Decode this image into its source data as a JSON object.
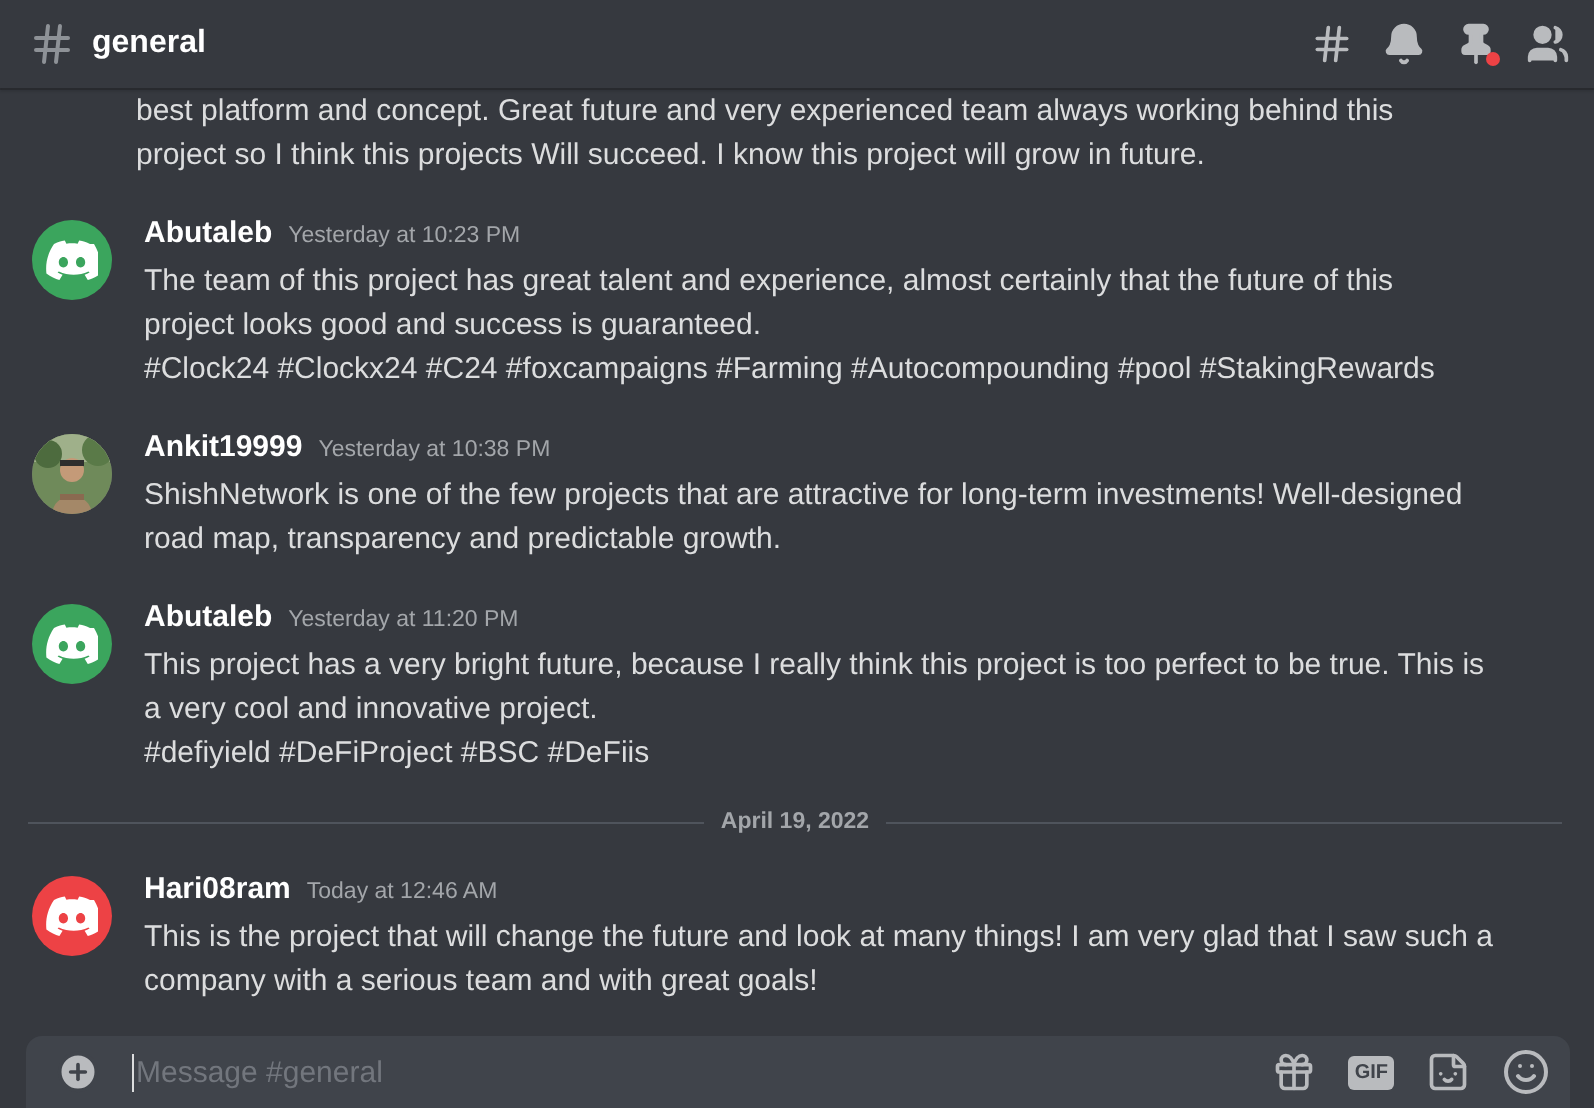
{
  "channel": {
    "name": "general"
  },
  "messages": [
    {
      "kind": "continuation",
      "lines": [
        "best platform and concept. Great future and very experienced team always working behind this",
        "project so I think this projects Will succeed. I know this project will grow in future."
      ]
    },
    {
      "kind": "message",
      "author": "Abutaleb",
      "time": "Yesterday at 10:23 PM",
      "avatar": {
        "kind": "logo",
        "color": "#3ba55d"
      },
      "lines": [
        "The team of this project has great talent and experience, almost certainly that the future of this",
        "project looks good and success is guaranteed.",
        "#Clock24 #Clockx24 #C24 #foxcampaigns #Farming #Autocompounding #pool #StakingRewards"
      ]
    },
    {
      "kind": "message",
      "author": "Ankit19999",
      "time": "Yesterday at 10:38 PM",
      "avatar": {
        "kind": "picture"
      },
      "lines": [
        "ShishNetwork  is one of the few projects that are attractive for long-term investments! Well-designed",
        "road map, transparency and predictable growth."
      ]
    },
    {
      "kind": "message",
      "author": "Abutaleb",
      "time": "Yesterday at 11:20 PM",
      "avatar": {
        "kind": "logo",
        "color": "#3ba55d"
      },
      "lines": [
        "This project has a very bright future, because I really think this project is too perfect to be true. This is",
        "a very cool and innovative project.",
        "#defiyield #DeFiProject #BSC #DeFiis"
      ]
    },
    {
      "kind": "divider",
      "label": "April 19, 2022"
    },
    {
      "kind": "message",
      "author": "Hari08ram",
      "time": "Today at 12:46 AM",
      "avatar": {
        "kind": "logo",
        "color": "#ed4245"
      },
      "lines": [
        "This is the project that will change the future and look at many things! I am very glad that I saw such a",
        "company with a serious team and with great goals!"
      ]
    }
  ],
  "composer": {
    "placeholder": "Message #general",
    "gif": "GIF"
  }
}
